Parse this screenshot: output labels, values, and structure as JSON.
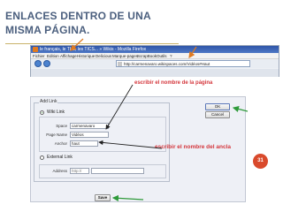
{
  "slide": {
    "title": "ENLACES DENTRO DE UNA MISMA PÁGINA.",
    "number": "31"
  },
  "browser": {
    "window_title": "le français, le TLE, les TICS... » Wikis - Mozilla Firefox",
    "menu": [
      "Fichier",
      "Edition",
      "Affichage",
      "Historique",
      "Delicious",
      "Marque-pages",
      "ScrapBook",
      "Outils",
      "?"
    ],
    "url": "http://carmenavaro.wikispaces.com/Vidéos#Haut"
  },
  "dialog": {
    "legend": "Add Link",
    "wiki_link_label": "Wiki Link",
    "space_label": "Space",
    "space_value": "carmenavaro",
    "page_name_label": "Page Name",
    "page_name_value": "Vidéos",
    "anchor_label": "Anchor",
    "anchor_value": "haut",
    "external_link_label": "External Link",
    "address_label": "Address",
    "address_value": "http://",
    "ok_label": "OK",
    "cancel_label": "Cancel",
    "save_label": "Save"
  },
  "annotations": {
    "page_hint": "escribir el nombre de la página",
    "anchor_hint": "escribir el nombre del ancla"
  },
  "colors": {
    "title": "#4b5f7e",
    "annotation": "#d4363c",
    "arrow_orange": "#e07b21",
    "arrow_green": "#2e9a3a",
    "badge": "#d94a2c"
  },
  "icons": [
    "firefox-icon",
    "back-icon",
    "forward-icon",
    "favicon-icon",
    "arrow-icon"
  ]
}
